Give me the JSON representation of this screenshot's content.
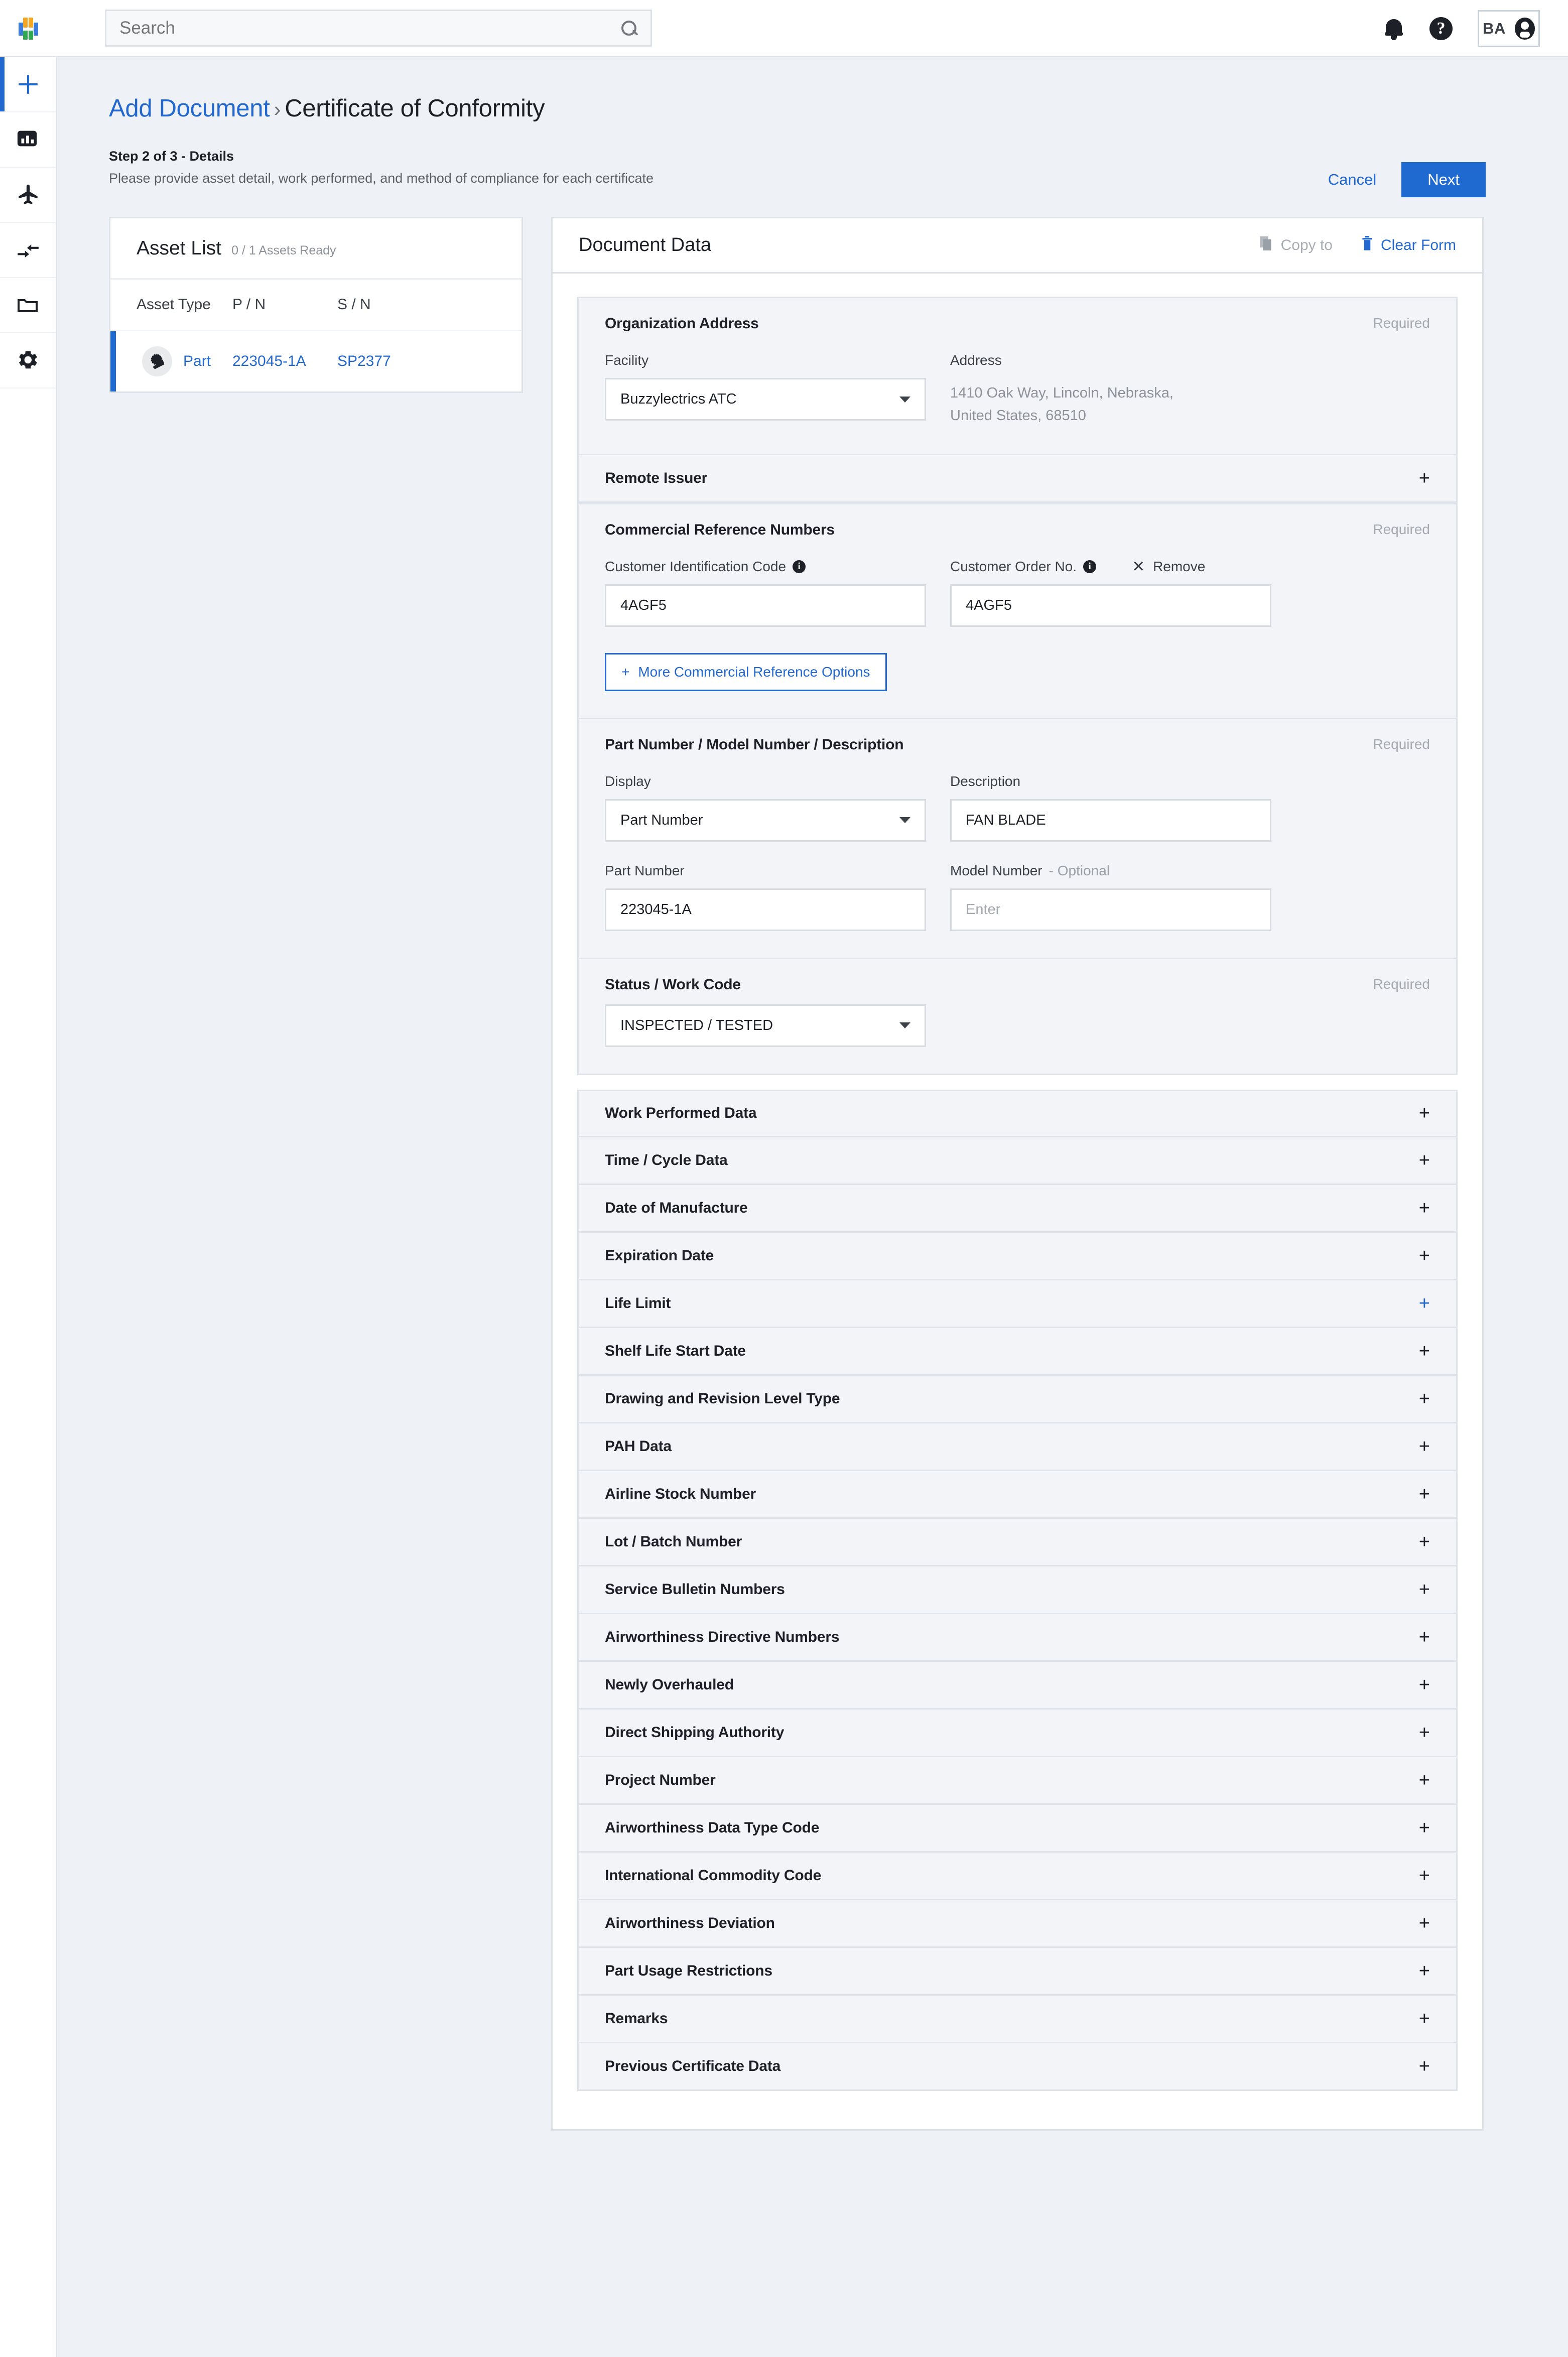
{
  "topbar": {
    "search_placeholder": "Search",
    "search_value": "",
    "user_initials": "BA",
    "icons": {
      "bell": "notifications-icon",
      "help": "help-icon",
      "avatar": "account-icon"
    }
  },
  "rail": {
    "items": [
      {
        "name": "add",
        "icon": "plus-icon",
        "active": true
      },
      {
        "name": "analytics",
        "icon": "chart-icon",
        "active": false
      },
      {
        "name": "aircraft",
        "icon": "airplane-icon",
        "active": false
      },
      {
        "name": "transfers",
        "icon": "transfer-arrows-icon",
        "active": false
      },
      {
        "name": "documents",
        "icon": "folder-icon",
        "active": false
      },
      {
        "name": "settings",
        "icon": "gear-icon",
        "active": false
      }
    ]
  },
  "page": {
    "breadcrumb_link": "Add Document",
    "breadcrumb_sep": "›",
    "breadcrumb_current": "Certificate of Conformity",
    "step_title": "Step 2 of 3 - Details",
    "step_subtitle": "Please provide asset detail, work performed, and method of compliance for each certificate",
    "cancel_label": "Cancel",
    "next_label": "Next",
    "accent_color": "#1f6ad1",
    "link_color": "#2268cf"
  },
  "asset_list": {
    "title": "Asset List",
    "count_text": "0 / 1 Assets Ready",
    "columns": [
      "Asset Type",
      "P / N",
      "S / N"
    ],
    "rows": [
      {
        "type": "Part",
        "pn": "223045-1A",
        "sn": "SP2377",
        "icon": "part-gear-icon",
        "selected": true
      }
    ]
  },
  "document_data": {
    "title": "Document Data",
    "copy_to_label": "Copy to",
    "clear_form_label": "Clear Form",
    "copy_to_icon": "copy-icon",
    "clear_form_icon": "trash-icon",
    "required_label": "Required",
    "sections": {
      "organization_address": {
        "title": "Organization Address",
        "required": "Required",
        "facility_label": "Facility",
        "facility_value": "Buzzylectrics ATC",
        "address_label": "Address",
        "address_value": "1410  Oak Way, Lincoln, Nebraska,\nUnited States, 68510"
      },
      "remote_issuer": {
        "title": "Remote Issuer"
      },
      "commercial_reference_numbers": {
        "title": "Commercial Reference Numbers",
        "required": "Required",
        "customer_id_label": "Customer Identification Code",
        "customer_id_value": "4AGF5",
        "customer_order_label": "Customer Order No.",
        "customer_order_value": "4AGF5",
        "remove_label": "Remove",
        "more_label": "More Commercial Reference Options"
      },
      "part_number": {
        "title": "Part Number / Model Number / Description",
        "required": "Required",
        "display_label": "Display",
        "display_value": "Part Number",
        "description_label": "Description",
        "description_value": "FAN BLADE",
        "part_number_label": "Part Number",
        "part_number_value": "223045-1A",
        "model_number_label": "Model Number",
        "model_number_optional": "- Optional",
        "model_number_placeholder": "Enter"
      },
      "status_work_code": {
        "title": "Status / Work Code",
        "required": "Required",
        "value": "INSPECTED / TESTED"
      }
    },
    "collapsed_sections": [
      {
        "title": "Work Performed Data",
        "hot": false
      },
      {
        "title": "Time / Cycle Data",
        "hot": false
      },
      {
        "title": "Date of Manufacture",
        "hot": false
      },
      {
        "title": "Expiration Date",
        "hot": false
      },
      {
        "title": "Life Limit",
        "hot": true
      },
      {
        "title": "Shelf Life Start Date",
        "hot": false
      },
      {
        "title": "Drawing and Revision Level Type",
        "hot": false
      },
      {
        "title": "PAH Data",
        "hot": false
      },
      {
        "title": "Airline Stock Number",
        "hot": false
      },
      {
        "title": "Lot / Batch Number",
        "hot": false
      },
      {
        "title": "Service Bulletin Numbers",
        "hot": false
      },
      {
        "title": "Airworthiness Directive Numbers",
        "hot": false
      },
      {
        "title": "Newly Overhauled",
        "hot": false
      },
      {
        "title": "Direct Shipping Authority",
        "hot": false
      },
      {
        "title": "Project Number",
        "hot": false
      },
      {
        "title": "Airworthiness Data Type Code",
        "hot": false
      },
      {
        "title": "International Commodity Code",
        "hot": false
      },
      {
        "title": "Airworthiness Deviation",
        "hot": false
      },
      {
        "title": "Part Usage Restrictions",
        "hot": false
      },
      {
        "title": "Remarks",
        "hot": false
      },
      {
        "title": "Previous Certificate Data",
        "hot": false
      }
    ]
  }
}
